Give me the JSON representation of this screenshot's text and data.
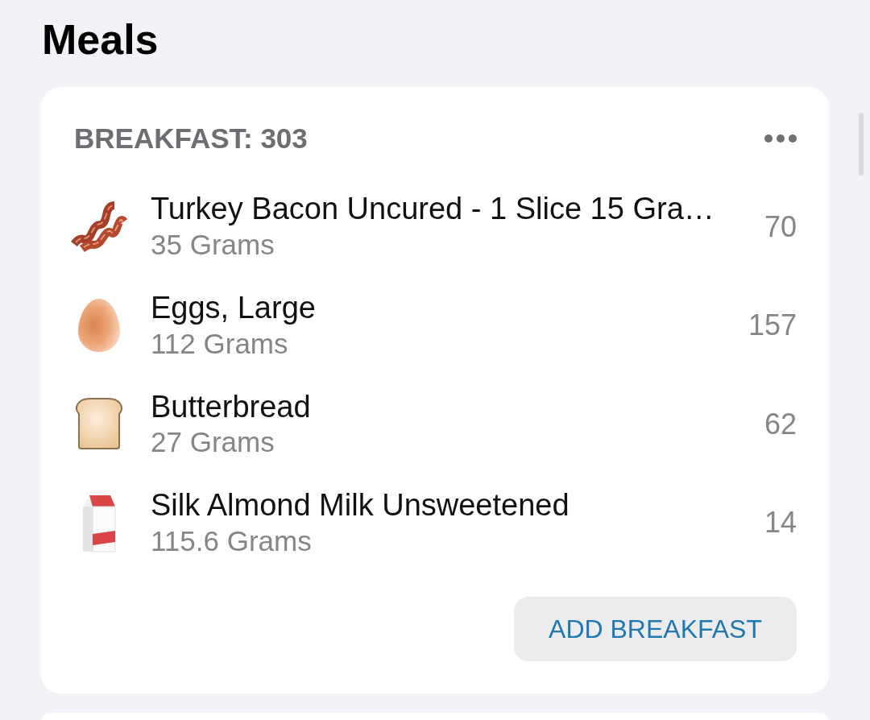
{
  "title": "Meals",
  "meal": {
    "header": "BREAKFAST: 303",
    "items": [
      {
        "name": "Turkey Bacon Uncured - 1 Slice 15 Gra…",
        "amount": "35 Grams",
        "calories": "70"
      },
      {
        "name": "Eggs, Large",
        "amount": "112 Grams",
        "calories": "157"
      },
      {
        "name": "Butterbread",
        "amount": "27 Grams",
        "calories": "62"
      },
      {
        "name": "Silk Almond Milk Unsweetened",
        "amount": "115.6 Grams",
        "calories": "14"
      }
    ],
    "add_button": "ADD BREAKFAST"
  }
}
